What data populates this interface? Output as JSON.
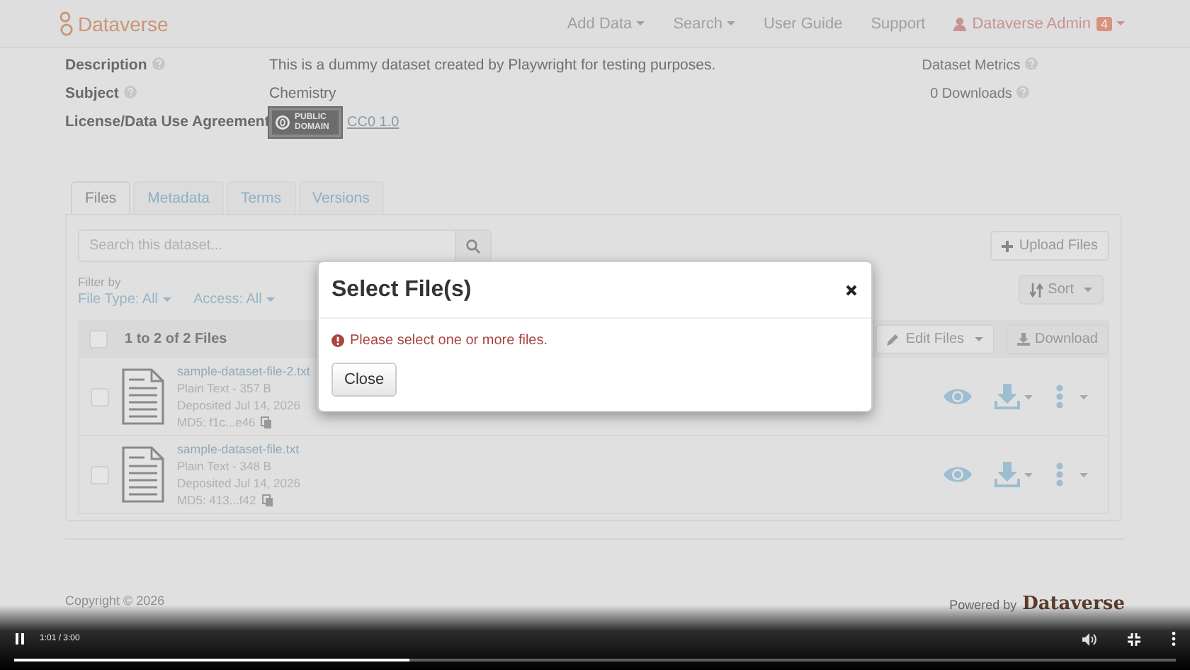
{
  "navbar": {
    "brand": "Dataverse",
    "menu": [
      {
        "label": "Add Data",
        "dropdown": true
      },
      {
        "label": "Search",
        "dropdown": true
      },
      {
        "label": "User Guide",
        "dropdown": false
      },
      {
        "label": "Support",
        "dropdown": false
      }
    ],
    "user": {
      "name": "Dataverse Admin",
      "badge": "4"
    }
  },
  "metadata": [
    {
      "kind": "text",
      "label": "Description",
      "help": true,
      "value": "This is a dummy dataset created by Playwright for testing purposes."
    },
    {
      "kind": "text",
      "label": "Subject",
      "help": true,
      "value": "Chemistry"
    },
    {
      "kind": "license",
      "label": "License/Data Use Agreement",
      "help": false,
      "badge_text": "PUBLIC DOMAIN",
      "link": "CC0 1.0"
    }
  ],
  "metrics": {
    "title": "Dataset Metrics",
    "downloads": "0 Downloads"
  },
  "tabs": [
    {
      "label": "Files",
      "selected": true
    },
    {
      "label": "Metadata",
      "selected": false
    },
    {
      "label": "Terms",
      "selected": false
    },
    {
      "label": "Versions",
      "selected": false
    }
  ],
  "files_panel": {
    "search": {
      "placeholder": "Search this dataset..."
    },
    "upload": "Upload Files",
    "filter_label": "Filter by",
    "filters": [
      "File Type: All",
      "Access: All"
    ],
    "sort": "Sort",
    "select_all_checked": false,
    "count": "1 to 2 of 2 Files",
    "edit": "Edit Files",
    "download": "Download",
    "files": [
      {
        "name": "sample-dataset-file-2.txt",
        "type": "Plain Text - 357 B",
        "deposited": "Deposited Jul 14, 2026",
        "md5": "MD5: f1c...e46",
        "checked": false
      },
      {
        "name": "sample-dataset-file.txt",
        "type": "Plain Text - 348 B",
        "deposited": "Deposited Jul 14, 2026",
        "md5": "MD5: 413...f42",
        "checked": false
      }
    ]
  },
  "modal": {
    "title": "Select File(s)",
    "message": "Please select one or more files.",
    "button": "Close"
  },
  "footer": {
    "copyright": "Copyright © 2026",
    "powered_by": "Powered by",
    "logo": "Dataverse"
  },
  "player": {
    "time": "1:01 / 3:00",
    "level": 0.34
  }
}
